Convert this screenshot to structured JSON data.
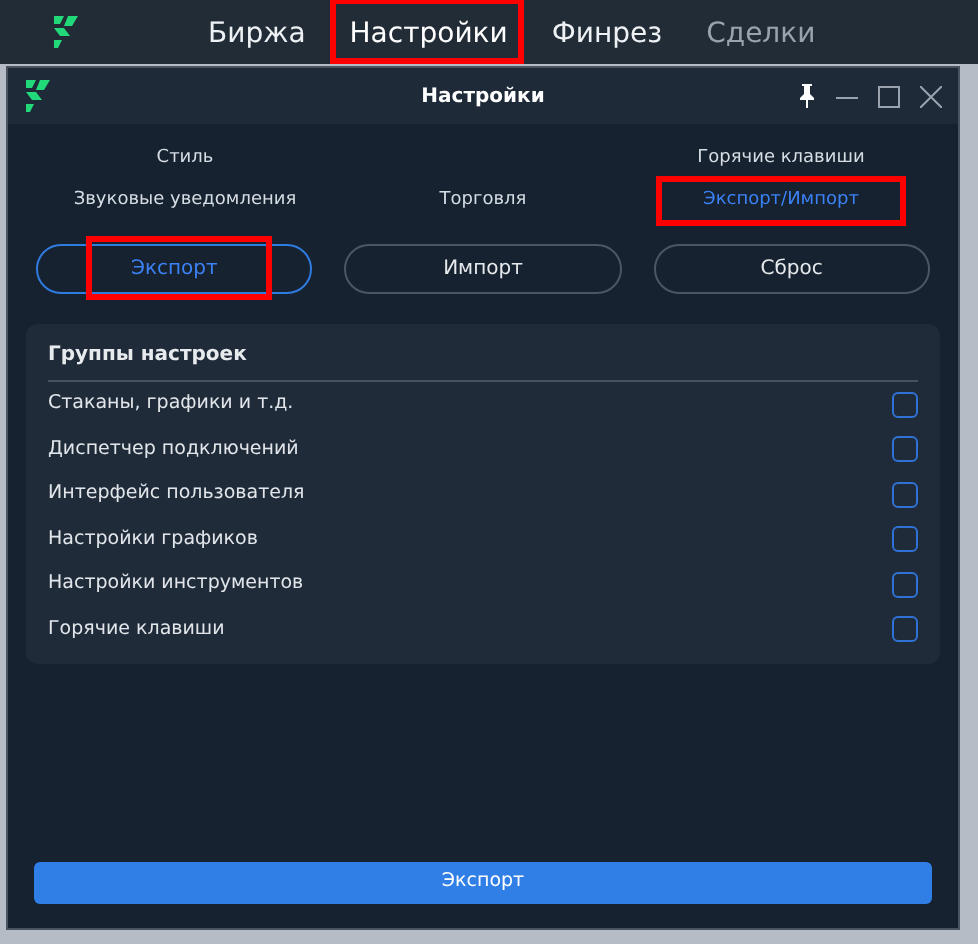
{
  "top_nav": [
    {
      "label": "Биржа",
      "selected": false,
      "highlighted": false
    },
    {
      "label": "Настройки",
      "selected": true,
      "highlighted": true
    },
    {
      "label": "Финрез",
      "selected": false,
      "highlighted": false
    },
    {
      "label": "Сделки",
      "selected": false,
      "highlighted": false
    }
  ],
  "window": {
    "title": "Настройки"
  },
  "tab_rows": [
    [
      {
        "label": "Стиль",
        "selected": false,
        "highlighted": false
      },
      {
        "label": "Горячие клавиши",
        "selected": false,
        "highlighted": false
      }
    ],
    [
      {
        "label": "Звуковые уведомления",
        "selected": false,
        "highlighted": false
      },
      {
        "label": "Торговля",
        "selected": false,
        "highlighted": false
      },
      {
        "label": "Экспорт/Импорт",
        "selected": true,
        "highlighted": true
      }
    ]
  ],
  "modes": [
    {
      "label": "Экспорт",
      "selected": true,
      "highlighted": true
    },
    {
      "label": "Импорт",
      "selected": false,
      "highlighted": false
    },
    {
      "label": "Сброс",
      "selected": false,
      "highlighted": false
    }
  ],
  "groups": {
    "title": "Группы настроек",
    "items": [
      {
        "label": "Стаканы, графики и т.д.",
        "checked": false
      },
      {
        "label": "Диспетчер подключений",
        "checked": false
      },
      {
        "label": "Интерфейс пользователя",
        "checked": false
      },
      {
        "label": "Настройки графиков",
        "checked": false
      },
      {
        "label": "Настройки инструментов",
        "checked": false
      },
      {
        "label": "Горячие клавиши",
        "checked": false
      }
    ]
  },
  "action_button": "Экспорт"
}
